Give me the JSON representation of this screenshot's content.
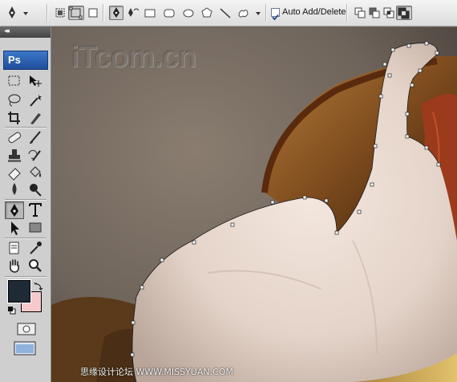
{
  "options_bar": {
    "auto_add_delete_label": "Auto Add/Delete",
    "auto_add_delete_checked": true,
    "tools": [
      "pen-tool-icon",
      "dropdown-arrow-icon",
      "shape-layers-icon",
      "paths-icon",
      "fill-pixels-icon",
      "pen-icon",
      "freeform-pen-icon",
      "rectangle-icon",
      "rounded-rectangle-icon",
      "ellipse-icon",
      "polygon-icon",
      "line-icon",
      "custom-shape-icon",
      "dropdown-arrow-icon",
      "add-path-icon",
      "subtract-path-icon",
      "intersect-path-icon",
      "exclude-path-icon"
    ]
  },
  "toolbox": {
    "collapse_label": "◂◂",
    "logo_text": "Ps",
    "tools": [
      "marquee",
      "move",
      "lasso",
      "magic-wand",
      "crop",
      "slice",
      "healing-brush",
      "brush",
      "clone-stamp",
      "history-brush",
      "eraser",
      "paint-bucket",
      "blur",
      "dodge",
      "pen",
      "type",
      "path-selection",
      "rectangle-shape",
      "notes",
      "eyedropper",
      "hand",
      "zoom"
    ],
    "foreground_color": "#1e2a36",
    "background_color": "#f6c9cc"
  },
  "watermark": {
    "logo_text": "iTcom.cn"
  },
  "footer_watermark": "思缘设计论坛 WWW.MISSYUAN.COM"
}
